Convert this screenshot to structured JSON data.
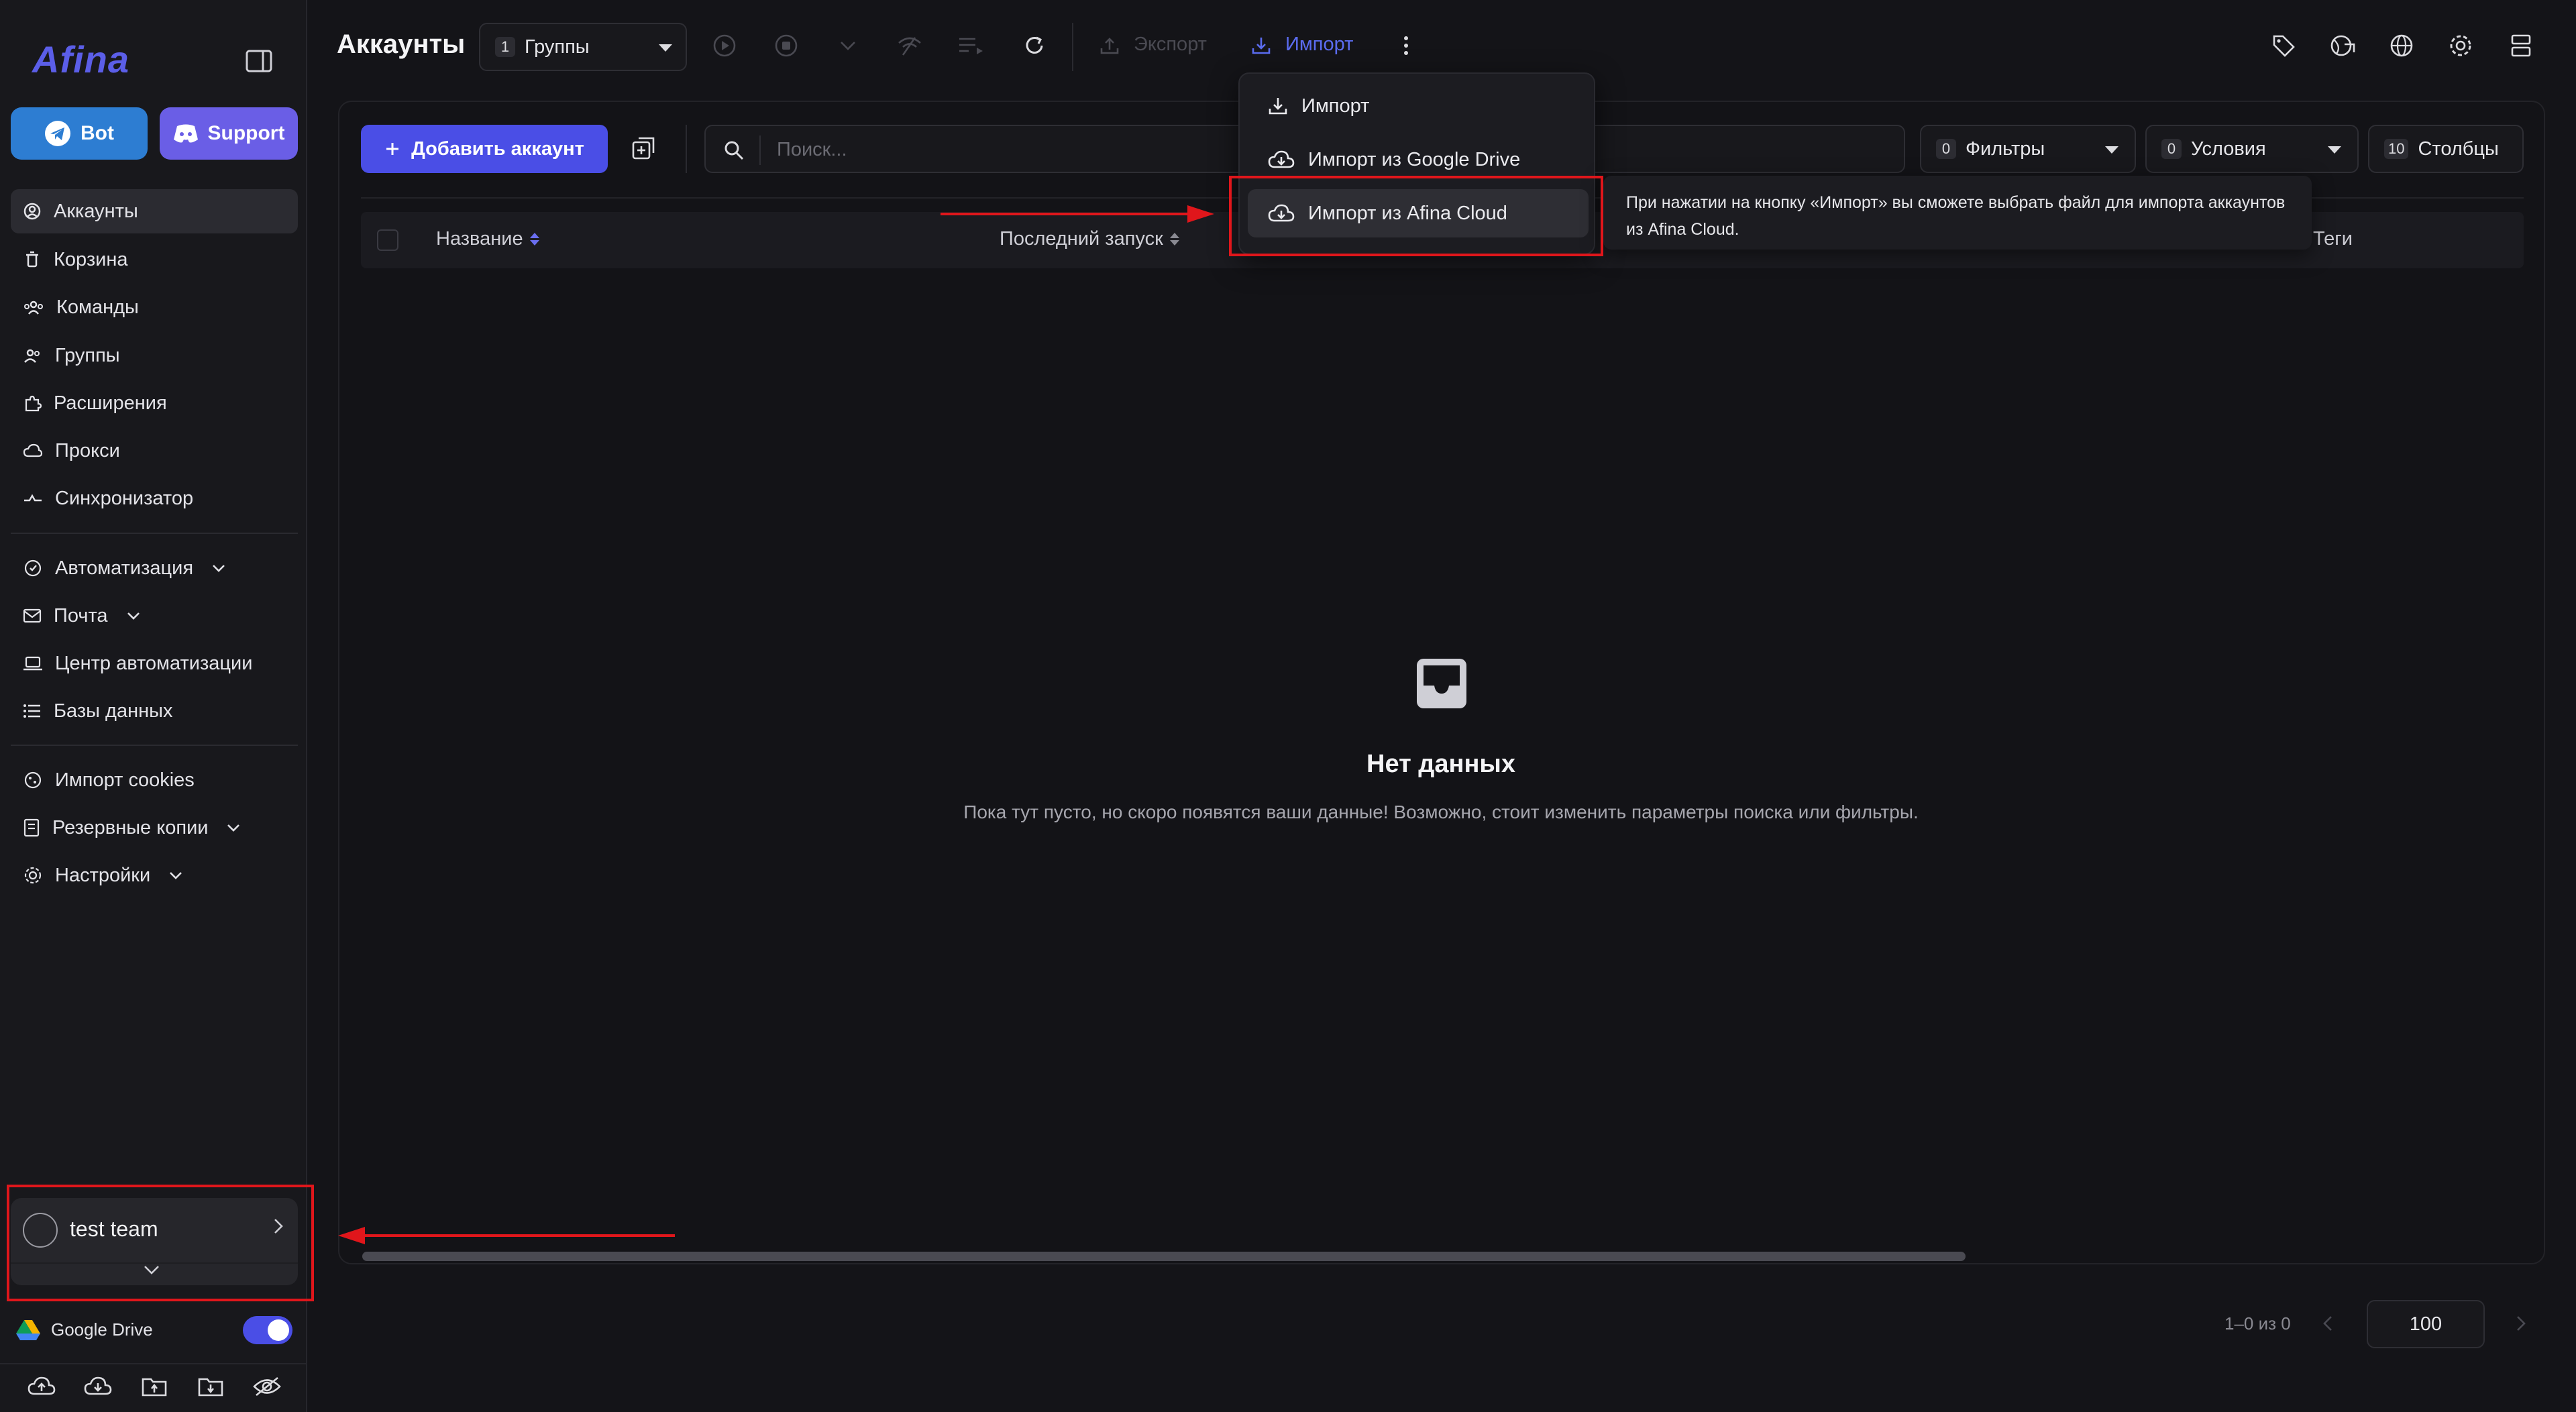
{
  "window": {
    "dot_colors": [
      "#ff5f57",
      "#febc2e",
      "#28c840"
    ]
  },
  "sidebar": {
    "logo": "Afina",
    "bot_label": "Bot",
    "support_label": "Support",
    "items_primary": [
      {
        "label": "Аккаунты",
        "icon": "user-circle-icon",
        "active": true
      },
      {
        "label": "Корзина",
        "icon": "trash-icon"
      },
      {
        "label": "Команды",
        "icon": "team-icon"
      },
      {
        "label": "Группы",
        "icon": "users-group-icon"
      },
      {
        "label": "Расширения",
        "icon": "puzzle-icon"
      },
      {
        "label": "Прокси",
        "icon": "cloud-icon"
      },
      {
        "label": "Синхронизатор",
        "icon": "sync-icon"
      }
    ],
    "items_automation": [
      {
        "label": "Автоматизация",
        "icon": "automation-icon",
        "expandable": true
      },
      {
        "label": "Почта",
        "icon": "mail-icon",
        "expandable": true
      },
      {
        "label": "Центр автоматизации",
        "icon": "laptop-icon"
      },
      {
        "label": "Базы данных",
        "icon": "list-icon"
      }
    ],
    "items_settings": [
      {
        "label": "Импорт cookies",
        "icon": "cookie-icon"
      },
      {
        "label": "Резервные копии",
        "icon": "backup-icon",
        "expandable": true
      },
      {
        "label": "Настройки",
        "icon": "gear-icon",
        "expandable": true
      }
    ],
    "team_name": "test team",
    "google_drive_label": "Google Drive",
    "google_drive_enabled": true
  },
  "header": {
    "title": "Аккаунты",
    "groups_count": "1",
    "groups_label": "Группы",
    "export_label": "Экспорт",
    "import_label": "Импорт"
  },
  "toolbar": {
    "add_account_label": "Добавить аккаунт",
    "search_placeholder": "Поиск...",
    "filters_count": "0",
    "filters_label": "Фильтры",
    "conditions_count": "0",
    "conditions_label": "Условия",
    "columns_count": "10",
    "columns_label": "Столбцы"
  },
  "table": {
    "columns": [
      "Название",
      "Последний запуск",
      "Теги"
    ]
  },
  "empty_state": {
    "title": "Нет данных",
    "subtitle": "Пока тут пусто, но скоро появятся ваши данные! Возможно, стоит изменить параметры поиска или фильтры."
  },
  "pagination": {
    "range_text": "1–0 из 0",
    "page_size": "100"
  },
  "import_menu": {
    "items": [
      "Импорт",
      "Импорт из Google Drive",
      "Импорт из Afina Cloud"
    ],
    "tooltip": "При нажатии на кнопку «Импорт» вы сможете выбрать файл для импорта аккаунтов из Afina Cloud."
  },
  "colors": {
    "accent": "#4a4ee6",
    "support": "#6a5ee6",
    "bot": "#2d7dd2",
    "annotation": "#e0161b",
    "import_link": "#5b6cf0"
  }
}
